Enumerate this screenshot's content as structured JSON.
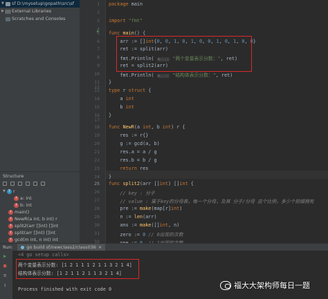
{
  "project": {
    "items": [
      {
        "label": "sf  D:\\mysetup\\gopath\\src\\sf",
        "icon": "folder-icon",
        "selected": true
      },
      {
        "label": "External Libraries",
        "icon": "library-icon",
        "selected": false
      },
      {
        "label": "Scratches and Consoles",
        "icon": "scratches-icon",
        "selected": false
      }
    ]
  },
  "structure": {
    "title": "Structure",
    "items": [
      {
        "label": "r",
        "badge": "T"
      },
      {
        "label": "a: int",
        "badge": "f"
      },
      {
        "label": "b: int",
        "badge": "f"
      },
      {
        "label": "main()",
        "badge": "f"
      },
      {
        "label": "NewR(a int, b int) r",
        "badge": "f"
      },
      {
        "label": "split2(arr []int) []int",
        "badge": "f"
      },
      {
        "label": "split(arr []int) []int",
        "badge": "f"
      },
      {
        "label": "gcd(m int, n int) int",
        "badge": "f"
      }
    ]
  },
  "editor": {
    "line_numbers": [
      "1",
      "2",
      "3",
      "4",
      "5",
      "6",
      "7",
      "8",
      "9",
      "10",
      "11",
      "12",
      "13",
      "14",
      "15",
      "16",
      "17",
      "18",
      "19",
      "20",
      "21",
      "22",
      "23",
      "24",
      "25",
      "26",
      "27",
      "28",
      "29",
      "30",
      "31",
      "32",
      "33",
      "34"
    ],
    "current_line": "25"
  },
  "run": {
    "label": "Run:",
    "tab": "go build sf/newclass2/class036",
    "console": {
      "cmd": "<4 go setup calls>",
      "out1": "两个变量表示分数: [1 2 1 1 1 2 1 1 3 2 1 4]",
      "out2": "结构体表示分数: [1 2 1 1 2 1 1 3 2 1 4]",
      "exit": "Process finished with exit code 0"
    }
  },
  "watermark": "福大大架构师每日一题",
  "colors": {
    "highlight_box": "#d92a2a",
    "keyword": "#cc7832",
    "string": "#6a8759",
    "number": "#6897bb",
    "function": "#ffc66d"
  }
}
